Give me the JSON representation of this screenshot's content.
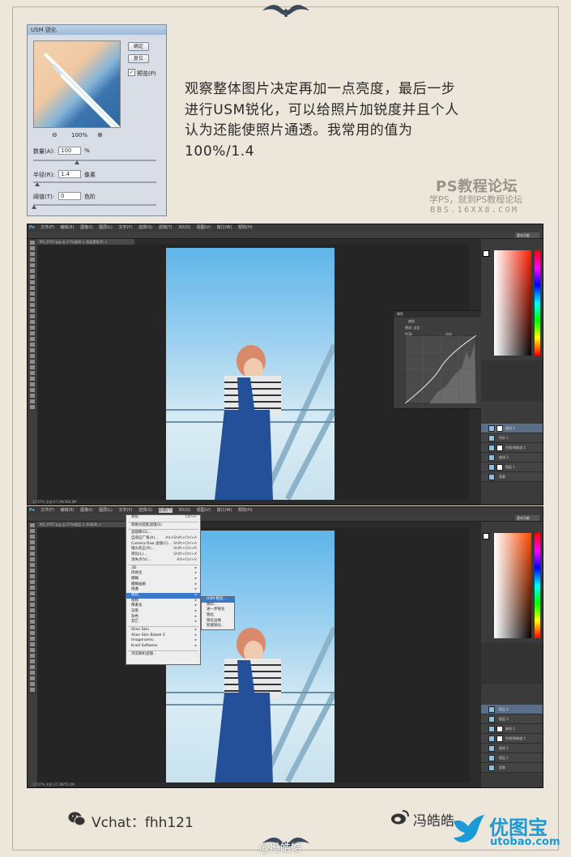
{
  "usm_dialog": {
    "title": "USM 锐化",
    "ok_label": "确定",
    "reset_label": "复位",
    "preview_label": "预览(P)",
    "preview_checked": true,
    "zoom_out_icon": "magnifier-minus-icon",
    "zoom_level": "100%",
    "zoom_in_icon": "magnifier-plus-icon",
    "amount_label": "数量(A):",
    "amount_value": "100",
    "amount_unit": "%",
    "radius_label": "半径(R):",
    "radius_value": "1.4",
    "radius_unit": "像素",
    "threshold_label": "阈值(T):",
    "threshold_value": "0",
    "threshold_unit": "色阶"
  },
  "description": {
    "line1": "观察整体图片决定再加一点亮度，最后一步",
    "line2": "进行USM锐化，可以给照片加锐度并且个人",
    "line3": "认为还能使照片通透。我常用的值为",
    "line4": "100%/1.4"
  },
  "watermark": {
    "title": "PS教程论坛",
    "subtitle": "学PS，就到PS教程论坛",
    "url": "BBS.16XX8.COM"
  },
  "ps_window_1": {
    "logo": "Ps",
    "menus": [
      "文件(F)",
      "编辑(E)",
      "图像(I)",
      "图层(L)",
      "文字(Y)",
      "选择(S)",
      "滤镜(T)",
      "3D(D)",
      "视图(V)",
      "窗口(W)",
      "帮助(H)"
    ],
    "doc_tab": "MG_9707.jpg @ 17%(曲线 1, 图层蒙版/8) ×",
    "status": "17.07%",
    "doc_size": "文档:37.2M/366.8M",
    "curves_panel_title": "属性",
    "curves_label": "曲线",
    "curves_preset": "预设:",
    "curves_preset_value": "自定",
    "curves_channel": "RGB",
    "curves_auto": "自动",
    "workspace": "基本功能",
    "layers": [
      {
        "name": "曲线 1",
        "selected": true
      },
      {
        "name": "色阶 1",
        "selected": false
      },
      {
        "name": "色相/饱和度 1",
        "selected": false
      },
      {
        "name": "曲线 2",
        "selected": false
      },
      {
        "name": "图层 1",
        "selected": false
      },
      {
        "name": "背景",
        "selected": false
      }
    ]
  },
  "ps_window_2": {
    "logo": "Ps",
    "menus": [
      "文件(F)",
      "编辑(E)",
      "图像(I)",
      "图层(L)",
      "文字(Y)",
      "选择(S)",
      "滤镜(T)",
      "3D(D)",
      "视图(V)",
      "窗口(W)",
      "帮助(H)"
    ],
    "doc_tab": "MG_9707.jpg @ 17%(图层 4, RGB/8) ×",
    "status": "17.07%",
    "doc_size": "文档:37.2M/55.4M",
    "workspace": "基本功能",
    "filter_menu": [
      {
        "label": "液化",
        "shortcut": "Ctrl+F"
      },
      {
        "sep": true
      },
      {
        "label": "转换为智能滤镜(S)",
        "shortcut": ""
      },
      {
        "sep": true
      },
      {
        "label": "滤镜库(G)...",
        "shortcut": ""
      },
      {
        "label": "自适应广角(A)...",
        "shortcut": "Alt+Shift+Ctrl+A"
      },
      {
        "label": "Camera Raw 滤镜(C)...",
        "shortcut": "Shift+Ctrl+A"
      },
      {
        "label": "镜头校正(R)...",
        "shortcut": "Shift+Ctrl+R"
      },
      {
        "label": "液化(L)...",
        "shortcut": "Shift+Ctrl+X"
      },
      {
        "label": "消失点(V)...",
        "shortcut": "Alt+Ctrl+V"
      },
      {
        "sep": true
      },
      {
        "label": "3D",
        "shortcut": "▸"
      },
      {
        "label": "风格化",
        "shortcut": "▸"
      },
      {
        "label": "模糊",
        "shortcut": "▸"
      },
      {
        "label": "模糊画廊",
        "shortcut": "▸"
      },
      {
        "label": "扭曲",
        "shortcut": "▸"
      },
      {
        "label": "锐化",
        "shortcut": "▸",
        "highlight": true
      },
      {
        "label": "视频",
        "shortcut": "▸"
      },
      {
        "label": "像素化",
        "shortcut": "▸"
      },
      {
        "label": "渲染",
        "shortcut": "▸"
      },
      {
        "label": "杂色",
        "shortcut": "▸"
      },
      {
        "label": "其它",
        "shortcut": "▸"
      },
      {
        "sep": true
      },
      {
        "label": "Alien Skin",
        "shortcut": "▸"
      },
      {
        "label": "Alien Skin Bokeh 2",
        "shortcut": "▸"
      },
      {
        "label": "Imagenomic",
        "shortcut": "▸"
      },
      {
        "label": "Knoll Software",
        "shortcut": "▸"
      },
      {
        "sep": true
      },
      {
        "label": "浏览联机滤镜...",
        "shortcut": ""
      }
    ],
    "sharpen_submenu": [
      {
        "label": "USM 锐化...",
        "highlight": true
      },
      {
        "label": "防抖...",
        "highlight": false
      },
      {
        "label": "进一步锐化",
        "highlight": false
      },
      {
        "label": "锐化",
        "highlight": false
      },
      {
        "label": "锐化边缘",
        "highlight": false
      },
      {
        "label": "智能锐化...",
        "highlight": false
      }
    ],
    "layers": [
      {
        "name": "图层 4",
        "selected": true
      },
      {
        "name": "图层 3",
        "selected": false
      },
      {
        "name": "曲线 1",
        "selected": false
      },
      {
        "name": "色相/饱和度 1",
        "selected": false
      },
      {
        "name": "曲线 2",
        "selected": false
      },
      {
        "name": "图层 1",
        "selected": false
      },
      {
        "name": "背景",
        "selected": false
      }
    ]
  },
  "footer": {
    "wechat_icon": "wechat-icon",
    "wechat_text": "Vchat：fhh121",
    "weibo_icon": "weibo-icon",
    "weibo_text": "冯皓皓",
    "weibo_handle": "@冯皓皓",
    "brand_icon": "utobao-bird-icon",
    "brand_cn": "优图宝",
    "brand_url": "utobao.com"
  },
  "colors": {
    "background": "#ece6db",
    "ps_dark": "#2b2b2b",
    "menu_highlight": "#3b78c9",
    "brand_blue": "#1a9bd7"
  }
}
